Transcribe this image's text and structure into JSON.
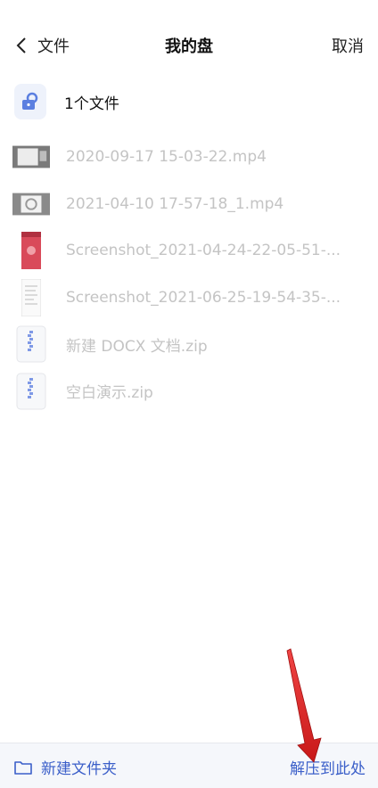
{
  "header": {
    "back_label": "文件",
    "title": "我的盘",
    "cancel_label": "取消"
  },
  "summary": {
    "count_label": "1个文件"
  },
  "files": [
    {
      "name": "2020-09-17 15-03-22.mp4",
      "type": "video"
    },
    {
      "name": "2021-04-10 17-57-18_1.mp4",
      "type": "video"
    },
    {
      "name": "Screenshot_2021-04-24-22-05-51-...",
      "type": "image"
    },
    {
      "name": "Screenshot_2021-06-25-19-54-35-...",
      "type": "image"
    },
    {
      "name": "新建 DOCX 文档.zip",
      "type": "zip"
    },
    {
      "name": "空白演示.zip",
      "type": "zip"
    }
  ],
  "bottom_bar": {
    "new_folder_label": "新建文件夹",
    "extract_here_label": "解压到此处"
  },
  "colors": {
    "accent": "#3b5fc9",
    "disabled_text": "#c4c4c4",
    "annotation_arrow": "#e02020"
  }
}
